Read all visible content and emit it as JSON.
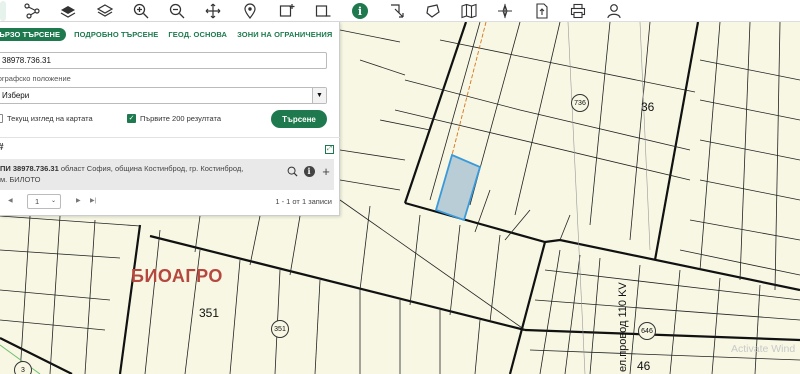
{
  "toolbar": {
    "tools": [
      "home-icon",
      "share-nodes-icon",
      "layers-icon",
      "layers-stack-icon",
      "zoom-in-icon",
      "zoom-out-icon",
      "pan-icon",
      "pin-icon",
      "add-rect-icon",
      "remove-rect-icon",
      "info-icon",
      "select-arrow-icon",
      "draw-polygon-icon",
      "map-icon",
      "compass-icon",
      "export-icon",
      "print-icon",
      "user-icon"
    ]
  },
  "search": {
    "tabs": [
      "БЪРЗО ТЪРСЕНЕ",
      "ПОДРОБНО ТЪРСЕНЕ",
      "ГЕОД. ОСНОВА",
      "ЗОНИ НА ОГРАНИЧЕНИЯ"
    ],
    "query": "38978.736.31",
    "location_label": "Географско положение",
    "location_value": "Избери",
    "current_view_label": "Текущ изглед на картата",
    "first200_label": "Първите 200 резултата",
    "search_button": "Търсене"
  },
  "results": {
    "header_icon": "#",
    "item_id": "ПИ 38978.736.31",
    "item_desc": " област София, община Костинброд, гр. Костинброд,",
    "item_locality": "м. БИЛОТО",
    "page_value": "1",
    "count_text": "1 - 1 от 1 записи"
  },
  "map": {
    "labels": {
      "n36": "36",
      "n736": "736",
      "n351_circle": "351",
      "n351": "351",
      "n646": "646",
      "n46": "46",
      "n3": "3",
      "bioagro": "БИОАГРО",
      "power_line": "ел.провод 110 KV"
    },
    "watermark": "Activate Wind"
  },
  "colors": {
    "accent": "#1e7a4e",
    "highlight": "#3a9ad9",
    "bioagro": "#b5473f"
  }
}
